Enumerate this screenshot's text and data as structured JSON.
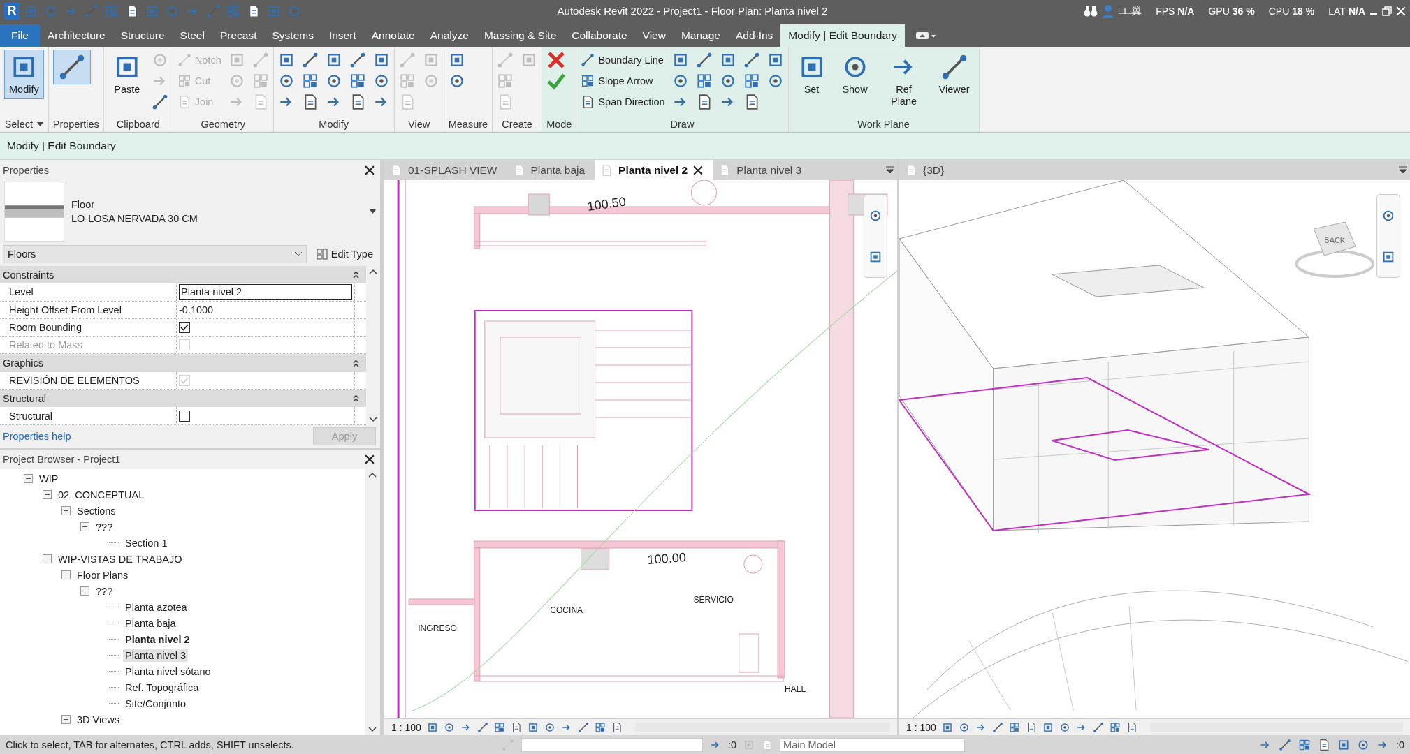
{
  "title_bar": {
    "app_logo": "R",
    "title": "Autodesk Revit 2022 - Project1 - Floor Plan: Planta nivel 2",
    "user": "□□翼",
    "stats": [
      {
        "label": "FPS",
        "value": "N/A"
      },
      {
        "label": "GPU",
        "value": "36 %"
      },
      {
        "label": "CPU",
        "value": "18 %"
      },
      {
        "label": "LAT",
        "value": "N/A"
      }
    ]
  },
  "menu_tabs": [
    {
      "label": "File",
      "kind": "file",
      "selected": false
    },
    {
      "label": "Architecture",
      "kind": "tab",
      "selected": false
    },
    {
      "label": "Structure",
      "kind": "tab",
      "selected": false
    },
    {
      "label": "Steel",
      "kind": "tab",
      "selected": false
    },
    {
      "label": "Precast",
      "kind": "tab",
      "selected": false
    },
    {
      "label": "Systems",
      "kind": "tab",
      "selected": false
    },
    {
      "label": "Insert",
      "kind": "tab",
      "selected": false
    },
    {
      "label": "Annotate",
      "kind": "tab",
      "selected": false
    },
    {
      "label": "Analyze",
      "kind": "tab",
      "selected": false
    },
    {
      "label": "Massing & Site",
      "kind": "tab",
      "selected": false
    },
    {
      "label": "Collaborate",
      "kind": "tab",
      "selected": false
    },
    {
      "label": "View",
      "kind": "tab",
      "selected": false
    },
    {
      "label": "Manage",
      "kind": "tab",
      "selected": false
    },
    {
      "label": "Add-Ins",
      "kind": "tab",
      "selected": false
    },
    {
      "label": "Modify | Edit Boundary",
      "kind": "context",
      "selected": true
    }
  ],
  "ribbon": [
    {
      "label": "Select",
      "dropdown": true,
      "contextual": false,
      "tools": [
        {
          "kind": "large",
          "label": "Modify",
          "selected": true,
          "disabled": false
        }
      ]
    },
    {
      "label": "Properties",
      "contextual": false,
      "tools": [
        {
          "kind": "large",
          "selected": true,
          "disabled": false
        }
      ]
    },
    {
      "label": "Clipboard",
      "contextual": false,
      "tools": [
        {
          "kind": "large",
          "label": "Paste",
          "selected": false,
          "disabled": false
        },
        {
          "kind": "icon",
          "disabled": true
        },
        {
          "kind": "icon",
          "disabled": true
        },
        {
          "kind": "icon",
          "disabled": false
        }
      ]
    },
    {
      "label": "Geometry",
      "contextual": false,
      "tools": [
        {
          "kind": "small",
          "label": "Notch",
          "disabled": true
        },
        {
          "kind": "small",
          "label": "Cut",
          "disabled": true
        },
        {
          "kind": "small",
          "label": "Join",
          "disabled": true
        },
        {
          "kind": "icon",
          "disabled": true
        },
        {
          "kind": "icon",
          "disabled": true
        },
        {
          "kind": "icon",
          "disabled": true
        },
        {
          "kind": "icon",
          "disabled": true
        },
        {
          "kind": "icon",
          "disabled": true
        },
        {
          "kind": "icon",
          "disabled": true
        }
      ]
    },
    {
      "label": "Modify",
      "contextual": false,
      "tools": [
        {
          "kind": "icon",
          "disabled": false
        },
        {
          "kind": "icon",
          "disabled": false
        },
        {
          "kind": "icon",
          "disabled": false
        },
        {
          "kind": "icon",
          "disabled": false
        },
        {
          "kind": "icon",
          "disabled": false
        },
        {
          "kind": "icon",
          "disabled": false
        },
        {
          "kind": "icon",
          "disabled": false
        },
        {
          "kind": "icon",
          "disabled": false
        },
        {
          "kind": "icon",
          "disabled": false
        },
        {
          "kind": "icon",
          "disabled": false
        },
        {
          "kind": "icon",
          "disabled": false
        },
        {
          "kind": "icon",
          "disabled": false
        },
        {
          "kind": "icon",
          "disabled": false
        },
        {
          "kind": "icon",
          "disabled": false
        },
        {
          "kind": "icon",
          "disabled": false
        }
      ]
    },
    {
      "label": "View",
      "contextual": false,
      "tools": [
        {
          "kind": "icon",
          "disabled": true
        },
        {
          "kind": "icon",
          "disabled": true
        },
        {
          "kind": "icon",
          "disabled": true
        },
        {
          "kind": "icon",
          "disabled": true
        },
        {
          "kind": "icon",
          "disabled": true
        }
      ]
    },
    {
      "label": "Measure",
      "contextual": false,
      "tools": [
        {
          "kind": "icon",
          "disabled": false
        },
        {
          "kind": "icon",
          "disabled": false
        }
      ]
    },
    {
      "label": "Create",
      "contextual": false,
      "tools": [
        {
          "kind": "icon",
          "disabled": true
        },
        {
          "kind": "icon",
          "disabled": true
        },
        {
          "kind": "icon",
          "disabled": true
        },
        {
          "kind": "icon",
          "disabled": true
        }
      ]
    },
    {
      "label": "Mode",
      "contextual": true,
      "tools": [
        {
          "kind": "cancel",
          "disabled": false
        },
        {
          "kind": "finish",
          "disabled": false
        }
      ]
    },
    {
      "label": "Draw",
      "contextual": true,
      "tools": [
        {
          "kind": "small",
          "label": "Boundary Line",
          "disabled": false
        },
        {
          "kind": "small",
          "label": "Slope Arrow",
          "disabled": false
        },
        {
          "kind": "small",
          "label": "Span Direction",
          "disabled": false
        },
        {
          "kind": "icon",
          "disabled": false
        },
        {
          "kind": "icon",
          "disabled": false
        },
        {
          "kind": "icon",
          "disabled": false
        },
        {
          "kind": "icon",
          "disabled": false
        },
        {
          "kind": "icon",
          "disabled": false
        },
        {
          "kind": "icon",
          "disabled": false
        },
        {
          "kind": "icon",
          "disabled": false
        },
        {
          "kind": "icon",
          "disabled": false
        },
        {
          "kind": "icon",
          "disabled": false
        },
        {
          "kind": "icon",
          "disabled": false
        },
        {
          "kind": "icon",
          "disabled": false
        },
        {
          "kind": "icon",
          "disabled": false
        },
        {
          "kind": "icon",
          "disabled": false
        },
        {
          "kind": "icon",
          "disabled": false
        }
      ]
    },
    {
      "label": "Work Plane",
      "contextual": true,
      "tools": [
        {
          "kind": "large",
          "label": "Set",
          "selected": false,
          "disabled": false
        },
        {
          "kind": "large",
          "label": "Show",
          "selected": false,
          "disabled": false
        },
        {
          "kind": "large",
          "label": "Ref Plane",
          "selected": false,
          "disabled": false
        },
        {
          "kind": "large",
          "label": "Viewer",
          "selected": false,
          "disabled": false
        }
      ]
    }
  ],
  "context_bar": "Modify | Edit Boundary",
  "properties": {
    "title": "Properties",
    "type_category": "Floor",
    "type_name": "LO-LOSA NERVADA 30 CM",
    "filter": "Floors",
    "edit_type": "Edit Type",
    "groups": [
      {
        "name": "Constraints",
        "rows": [
          {
            "name": "Level",
            "kind": "text",
            "value": "Planta nivel 2",
            "editing": true
          },
          {
            "name": "Height Offset From Level",
            "kind": "text",
            "value": "-0.1000",
            "editing": false
          },
          {
            "name": "Room Bounding",
            "kind": "check",
            "checked": true,
            "disabled": false,
            "dimmed": false
          },
          {
            "name": "Related to Mass",
            "kind": "check",
            "checked": false,
            "disabled": true,
            "dimmed": true
          }
        ]
      },
      {
        "name": "Graphics",
        "rows": [
          {
            "name": "REVISIÓN DE ELEMENTOS",
            "kind": "check",
            "checked": true,
            "disabled": true,
            "dimmed": false
          }
        ]
      },
      {
        "name": "Structural",
        "rows": [
          {
            "name": "Structural",
            "kind": "check",
            "checked": false,
            "disabled": false,
            "dimmed": false
          }
        ]
      }
    ],
    "help": "Properties help",
    "apply": "Apply"
  },
  "project_browser": {
    "title": "Project Browser - Project1",
    "tree": [
      {
        "label": "WIP",
        "expanded": true,
        "selected": false,
        "current": false,
        "children": [
          {
            "label": "02. CONCEPTUAL",
            "expanded": true,
            "selected": false,
            "current": false,
            "children": [
              {
                "label": "Sections",
                "expanded": true,
                "selected": false,
                "current": false,
                "children": [
                  {
                    "label": "???",
                    "expanded": true,
                    "selected": false,
                    "current": false,
                    "children": [
                      {
                        "label": "Section 1",
                        "selected": false,
                        "current": false
                      }
                    ]
                  }
                ]
              }
            ]
          },
          {
            "label": "WIP-VISTAS DE TRABAJO",
            "expanded": true,
            "selected": false,
            "current": false,
            "children": [
              {
                "label": "Floor Plans",
                "expanded": true,
                "selected": false,
                "current": false,
                "children": [
                  {
                    "label": "???",
                    "expanded": true,
                    "selected": false,
                    "current": false,
                    "children": [
                      {
                        "label": "Planta azotea",
                        "selected": false,
                        "current": false
                      },
                      {
                        "label": "Planta baja",
                        "selected": false,
                        "current": false
                      },
                      {
                        "label": "Planta nivel 2",
                        "selected": false,
                        "current": true
                      },
                      {
                        "label": "Planta nivel 3",
                        "selected": true,
                        "current": false
                      },
                      {
                        "label": "Planta nivel sótano",
                        "selected": false,
                        "current": false
                      },
                      {
                        "label": "Ref. Topográfica",
                        "selected": false,
                        "current": false
                      },
                      {
                        "label": "Site/Conjunto",
                        "selected": false,
                        "current": false
                      }
                    ]
                  }
                ]
              },
              {
                "label": "3D Views",
                "expanded": true,
                "selected": false,
                "current": false
              }
            ]
          }
        ]
      }
    ]
  },
  "plan_view": {
    "tabs": [
      {
        "label": "01-SPLASH VIEW",
        "selected": false
      },
      {
        "label": "Planta baja",
        "selected": false
      },
      {
        "label": "Planta nivel 2",
        "selected": true
      },
      {
        "label": "Planta nivel 3",
        "selected": false
      }
    ],
    "labels": [
      "100.50",
      "100.00",
      "COCINA",
      "SERVICIO",
      "INGRESO",
      "HALL"
    ],
    "scale": "1 : 100"
  },
  "view_3d": {
    "tabs": [
      {
        "label": "{3D}",
        "selected": false
      }
    ],
    "view_cube": "BACK",
    "scale": "1 : 100"
  },
  "status_bar": {
    "message": "Click to select, TAB for alternates, CTRL adds, SHIFT unselects.",
    "selection_count": ":0",
    "workset": "Main Model",
    "filter_count": ":0"
  }
}
